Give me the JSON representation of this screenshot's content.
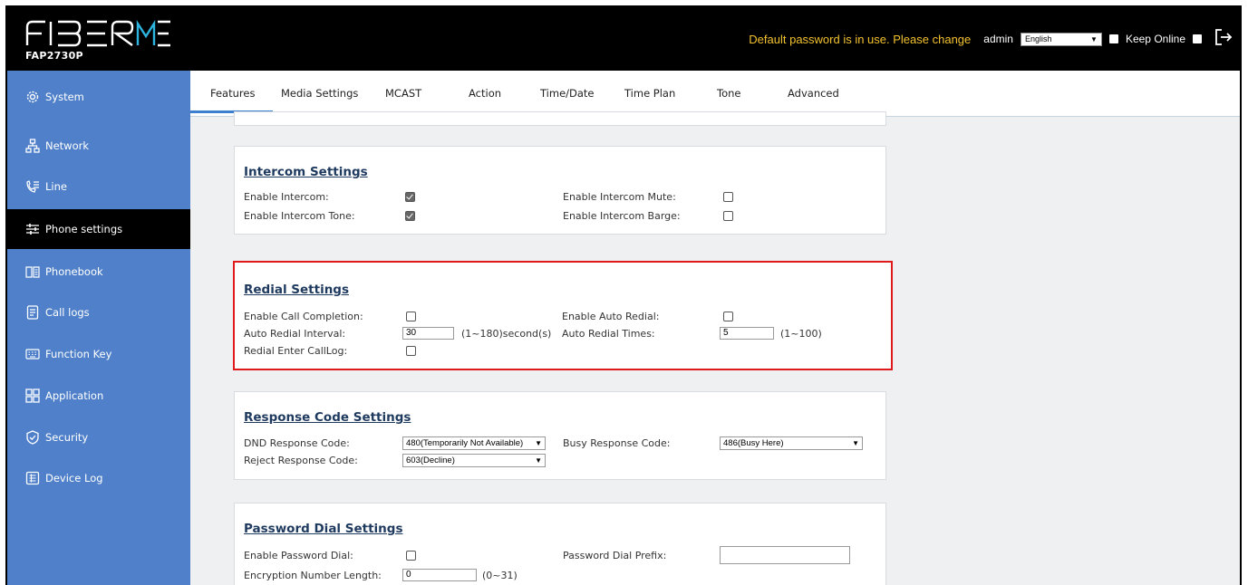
{
  "header": {
    "model": "FAP2730P",
    "warning": "Default password is in use. Please change",
    "user": "admin",
    "language": "English",
    "keep_online": "Keep Online"
  },
  "sidebar": {
    "items": [
      {
        "label": "System",
        "icon": "gear-icon"
      },
      {
        "label": "Network",
        "icon": "network-icon"
      },
      {
        "label": "Line",
        "icon": "phone-line-icon"
      },
      {
        "label": "Phone settings",
        "icon": "sliders-icon"
      },
      {
        "label": "Phonebook",
        "icon": "book-icon"
      },
      {
        "label": "Call logs",
        "icon": "document-icon"
      },
      {
        "label": "Function Key",
        "icon": "keyboard-icon"
      },
      {
        "label": "Application",
        "icon": "grid-icon"
      },
      {
        "label": "Security",
        "icon": "shield-icon"
      },
      {
        "label": "Device Log",
        "icon": "log-icon"
      }
    ],
    "active": "Phone settings"
  },
  "tabs": [
    "Features",
    "Media Settings",
    "MCAST",
    "Action",
    "Time/Date",
    "Time Plan",
    "Tone",
    "Advanced"
  ],
  "intercom": {
    "title": "Intercom Settings",
    "enable_intercom": "Enable Intercom:",
    "enable_intercom_tone": "Enable Intercom Tone:",
    "enable_intercom_mute": "Enable Intercom Mute:",
    "enable_intercom_barge": "Enable Intercom Barge:",
    "values": {
      "intercom": true,
      "tone": true,
      "mute": false,
      "barge": false
    }
  },
  "redial": {
    "title": "Redial Settings",
    "enable_call_completion": "Enable Call Completion:",
    "auto_redial_interval": "Auto Redial Interval:",
    "interval_value": "30",
    "interval_range": "(1~180)second(s)",
    "redial_enter_calllog": "Redial Enter CallLog:",
    "enable_auto_redial": "Enable Auto Redial:",
    "auto_redial_times": "Auto Redial Times:",
    "times_value": "5",
    "times_range": "(1~100)"
  },
  "response": {
    "title": "Response Code Settings",
    "dnd_label": "DND Response Code:",
    "dnd_value": "480(Temporarily Not Available)",
    "reject_label": "Reject Response Code:",
    "reject_value": "603(Decline)",
    "busy_label": "Busy Response Code:",
    "busy_value": "486(Busy Here)"
  },
  "password_dial": {
    "title": "Password Dial Settings",
    "enable_label": "Enable Password Dial:",
    "length_label": "Encryption Number Length:",
    "length_value": "0",
    "length_range": "(0~31)",
    "prefix_label": "Password Dial Prefix:",
    "prefix_value": ""
  },
  "colors": {
    "sidebar": "#4f80c9",
    "warning": "#f2c12e",
    "highlight": "#e0191b",
    "accent": "#3a7fd0"
  }
}
